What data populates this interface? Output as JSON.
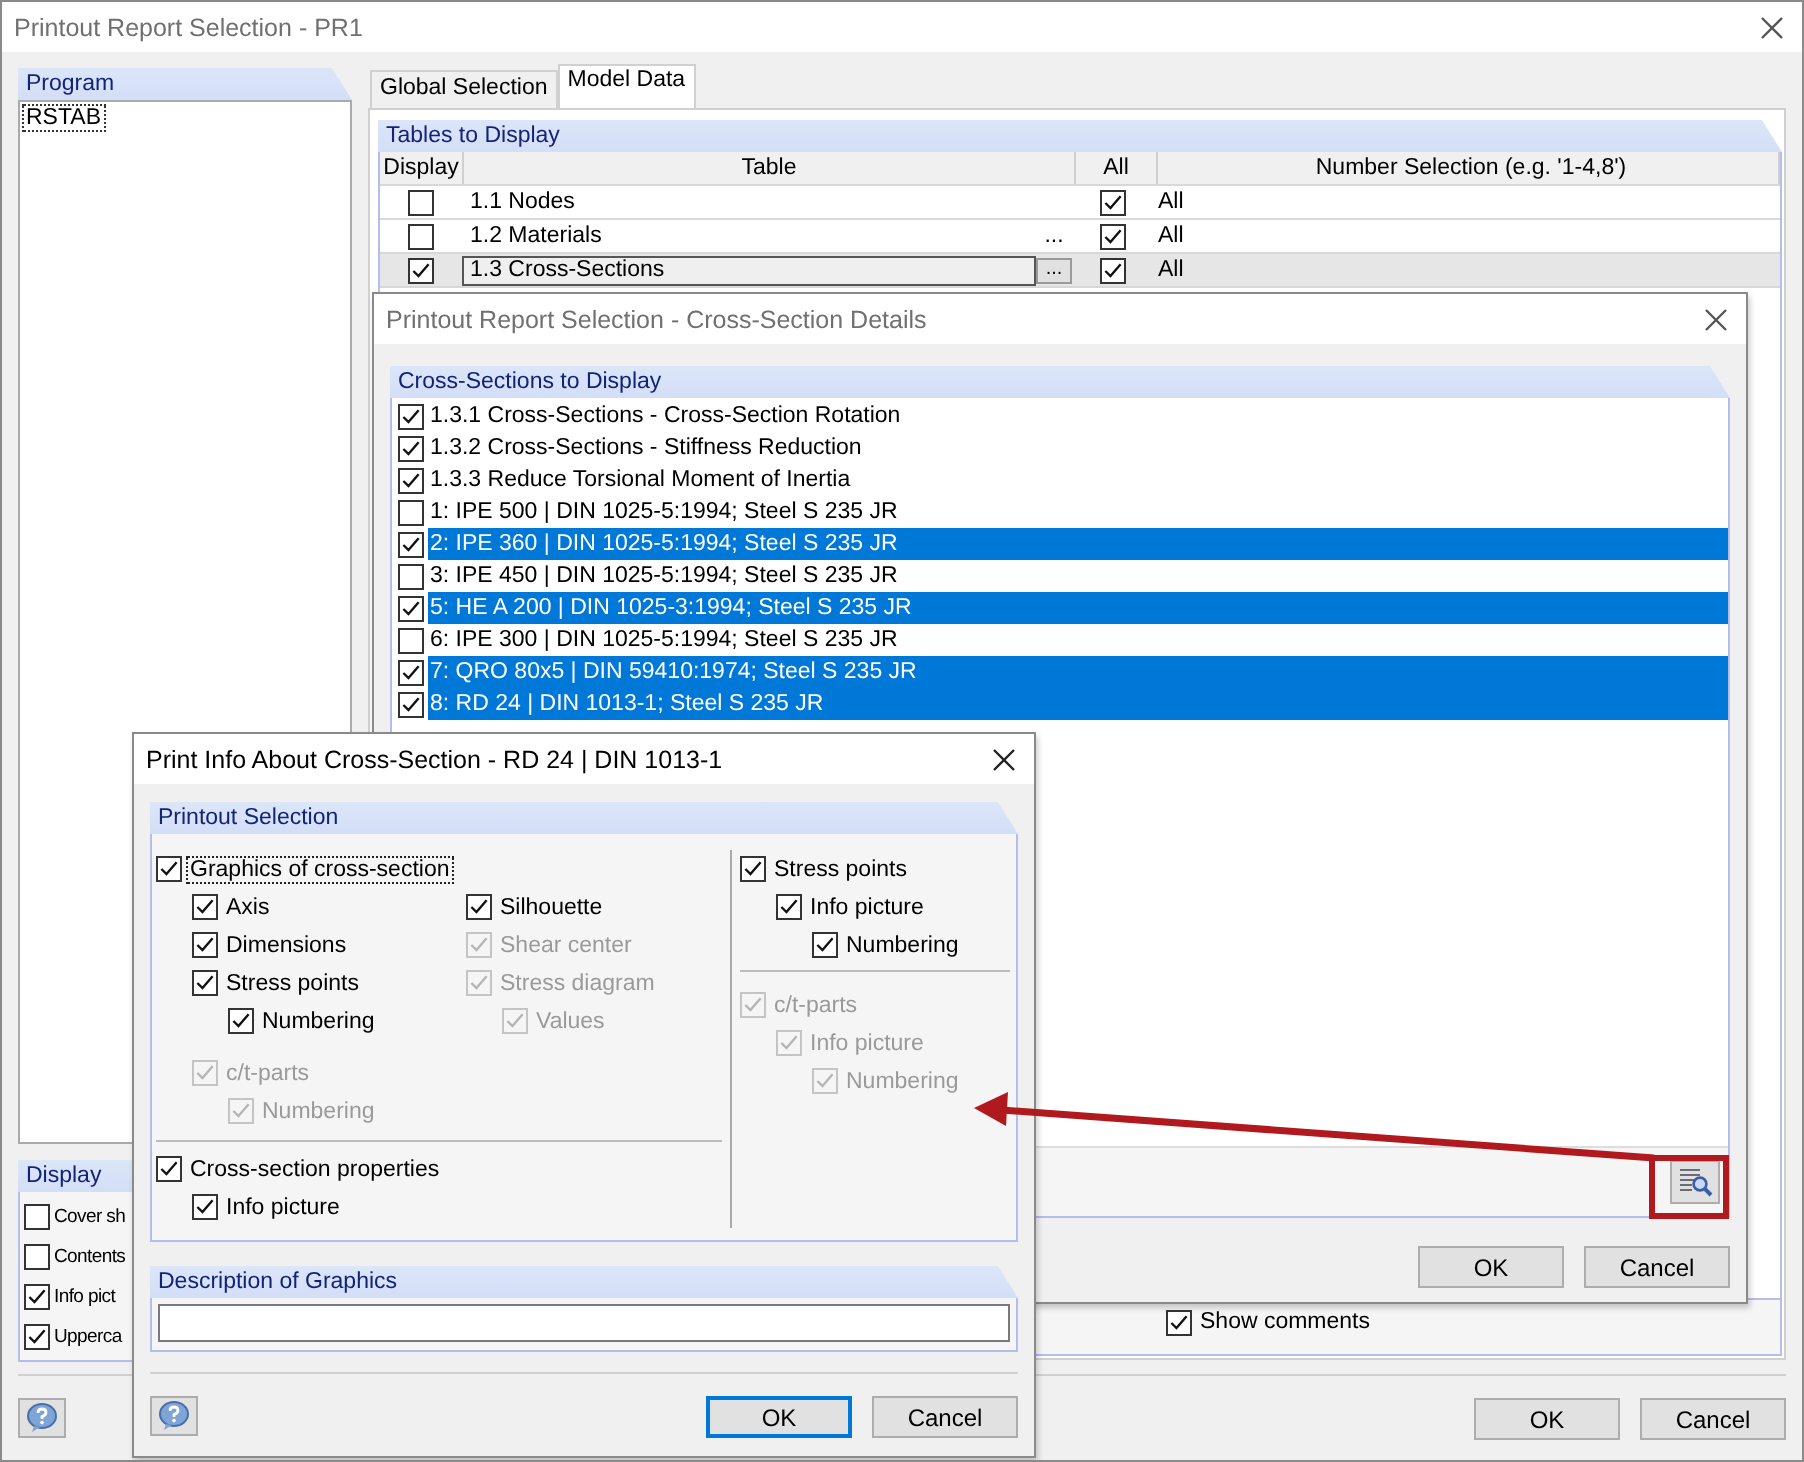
{
  "main_window": {
    "title": "Printout Report Selection - PR1",
    "program": {
      "heading": "Program",
      "items": [
        {
          "label": "RSTAB",
          "selected": true
        }
      ]
    },
    "display": {
      "heading": "Display",
      "options": [
        {
          "label": "Cover sh",
          "checked": false
        },
        {
          "label": "Contents",
          "checked": false
        },
        {
          "label": "Info pict",
          "checked": true
        },
        {
          "label": "Upperca",
          "checked": true
        }
      ]
    },
    "tabs": [
      {
        "label": "Global Selection",
        "selected": false
      },
      {
        "label": "Model Data",
        "selected": true
      }
    ],
    "tables": {
      "heading": "Tables to Display",
      "columns": [
        "Display",
        "Table",
        "All",
        "Number Selection (e.g. '1-4,8')"
      ],
      "rows": [
        {
          "display": false,
          "table": "1.1 Nodes",
          "all": true,
          "numbers": "All",
          "selected": false
        },
        {
          "display": false,
          "table": "1.2 Materials",
          "more": "...",
          "all": true,
          "numbers": "All",
          "selected": false
        },
        {
          "display": true,
          "table": "1.3 Cross-Sections",
          "more": "...",
          "all": true,
          "numbers": "All",
          "selected": true
        }
      ]
    },
    "show_comments": {
      "label": "Show comments",
      "checked": true
    },
    "buttons": [
      {
        "label": "OK"
      },
      {
        "label": "Cancel"
      }
    ]
  },
  "details_dialog": {
    "title": "Printout Report Selection - Cross-Section Details",
    "group": "Cross-Sections to Display",
    "items": [
      {
        "label": "1.3.1 Cross-Sections - Cross-Section Rotation",
        "checked": true,
        "selected": false
      },
      {
        "label": "1.3.2 Cross-Sections - Stiffness Reduction",
        "checked": true,
        "selected": false
      },
      {
        "label": "1.3.3 Reduce Torsional Moment of Inertia",
        "checked": true,
        "selected": false
      },
      {
        "label": "1: IPE 500 | DIN 1025-5:1994; Steel S 235 JR",
        "checked": false,
        "selected": false
      },
      {
        "label": "2: IPE 360 | DIN 1025-5:1994; Steel S 235 JR",
        "checked": true,
        "selected": true
      },
      {
        "label": "3: IPE 450 | DIN 1025-5:1994; Steel S 235 JR",
        "checked": false,
        "selected": false
      },
      {
        "label": "5: HE A 200 | DIN 1025-3:1994; Steel S 235 JR",
        "checked": true,
        "selected": true
      },
      {
        "label": "6: IPE 300 | DIN 1025-5:1994; Steel S 235 JR",
        "checked": false,
        "selected": false
      },
      {
        "label": "7: QRO 80x5 | DIN 59410:1974; Steel S 235 JR",
        "checked": true,
        "selected": true
      },
      {
        "label": "8: RD 24 | DIN 1013-1; Steel S 235 JR",
        "checked": true,
        "selected": true
      }
    ],
    "buttons": [
      {
        "label": "OK"
      },
      {
        "label": "Cancel"
      }
    ]
  },
  "info_dialog": {
    "title": "Print Info About Cross-Section - RD 24 | DIN 1013-1",
    "group": "Printout Selection",
    "graphics": {
      "label": "Graphics of cross-section",
      "checked": true,
      "disabled": false,
      "focused": true,
      "columns": [
        [
          {
            "label": "Axis",
            "checked": true,
            "disabled": false
          },
          {
            "label": "Dimensions",
            "checked": true,
            "disabled": false
          },
          {
            "label": "Stress points",
            "checked": true,
            "disabled": false,
            "children": [
              {
                "label": "Numbering",
                "checked": true,
                "disabled": false
              }
            ]
          }
        ],
        [
          {
            "label": "Silhouette",
            "checked": true,
            "disabled": false
          },
          {
            "label": "Shear center",
            "checked": true,
            "disabled": true
          },
          {
            "label": "Stress diagram",
            "checked": true,
            "disabled": true,
            "children": [
              {
                "label": "Values",
                "checked": true,
                "disabled": true
              }
            ]
          }
        ]
      ]
    },
    "ct_parts": {
      "label": "c/t-parts",
      "checked": true,
      "disabled": true,
      "children": [
        {
          "label": "Numbering",
          "checked": true,
          "disabled": true
        }
      ]
    },
    "properties": {
      "label": "Cross-section properties",
      "checked": true,
      "disabled": false,
      "children": [
        {
          "label": "Info picture",
          "checked": true,
          "disabled": false
        }
      ]
    },
    "stress_points": {
      "label": "Stress points",
      "checked": true,
      "disabled": false,
      "children": [
        {
          "label": "Info picture",
          "checked": true,
          "disabled": false,
          "children": [
            {
              "label": "Numbering",
              "checked": true,
              "disabled": false
            }
          ]
        }
      ]
    },
    "ct_parts_right": {
      "label": "c/t-parts",
      "checked": true,
      "disabled": true,
      "children": [
        {
          "label": "Info picture",
          "checked": true,
          "disabled": true,
          "children": [
            {
              "label": "Numbering",
              "checked": true,
              "disabled": true
            }
          ]
        }
      ]
    },
    "description": {
      "heading": "Description of Graphics"
    },
    "buttons": [
      {
        "label": "OK",
        "default": true
      },
      {
        "label": "Cancel",
        "default": false
      }
    ]
  }
}
